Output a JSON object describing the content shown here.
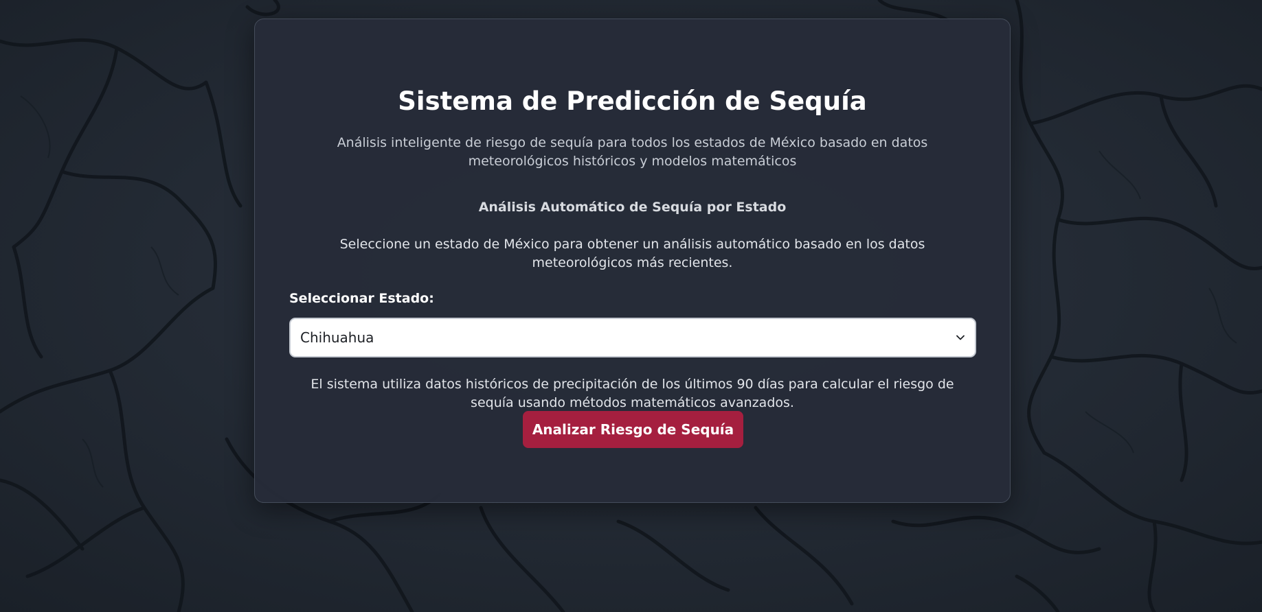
{
  "header": {
    "title": "Sistema de Predicción de Sequía",
    "subtitle": "Análisis inteligente de riesgo de sequía para todos los estados de México basado en datos meteorológicos históricos y modelos matemáticos"
  },
  "analysis": {
    "heading": "Análisis Automático de Sequía por Estado",
    "instructions": "Seleccione un estado de México para obtener un análisis automático basado en los datos meteorológicos más recientes.",
    "state_label": "Seleccionar Estado:",
    "state_selected": "Chihuahua",
    "note": "El sistema utiliza datos históricos de precipitación de los últimos 90 días para calcular el riesgo de sequía usando métodos matemáticos avanzados.",
    "button_label": "Analizar Riesgo de Sequía"
  },
  "icons": {
    "select_arrow": "chevron-down-icon"
  },
  "colors": {
    "accent_button": "#a51f3f",
    "card_background": "#262c38",
    "page_background": "#1f2630"
  }
}
